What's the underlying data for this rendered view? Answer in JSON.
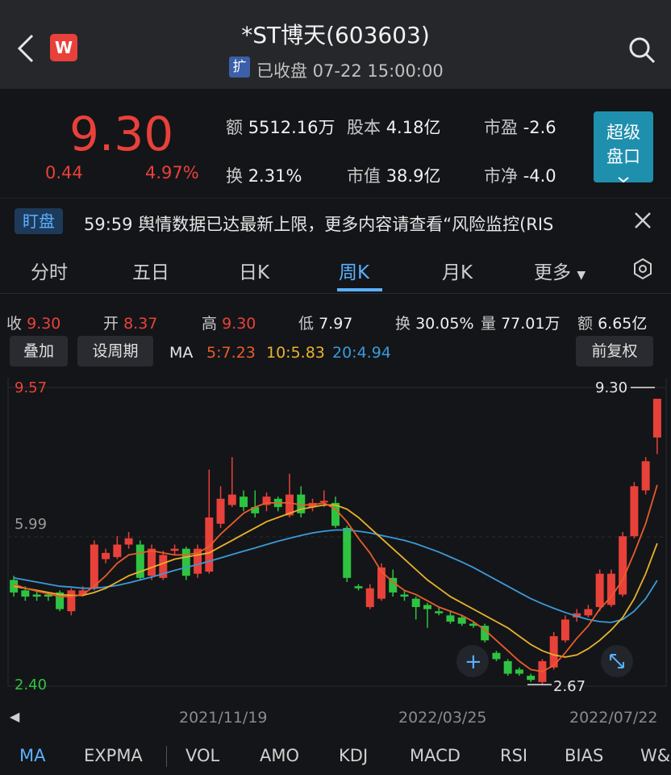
{
  "header": {
    "title": "*ST博天(603603)",
    "expand_tag": "扩",
    "status": "已收盘 07-22 15:00:00"
  },
  "quote": {
    "price": "9.30",
    "change": "0.44",
    "change_pct": "4.97%",
    "stats": [
      {
        "label": "额",
        "value": "5512.16万"
      },
      {
        "label": "股本",
        "value": "4.18亿"
      },
      {
        "label": "市盈",
        "value": "-2.6"
      },
      {
        "label": "换",
        "value": "2.31%"
      },
      {
        "label": "市值",
        "value": "38.9亿"
      },
      {
        "label": "市净",
        "value": "-4.0"
      }
    ],
    "super_button": [
      "超级",
      "盘口"
    ]
  },
  "marquee": {
    "tag": "盯盘",
    "text": "59:59 舆情数据已达最新上限，更多内容请查看“风险监控(RIS"
  },
  "tabs": [
    "分时",
    "五日",
    "日K",
    "周K",
    "月K",
    "更多"
  ],
  "active_tab": "周K",
  "ohlc": [
    {
      "label": "收",
      "value": "9.30",
      "color": "red"
    },
    {
      "label": "开",
      "value": "8.37",
      "color": "red"
    },
    {
      "label": "高",
      "value": "9.30",
      "color": "red"
    },
    {
      "label": "低",
      "value": "7.97",
      "color": "white"
    },
    {
      "label": "换",
      "value": "30.05%",
      "color": "white"
    },
    {
      "label": "量",
      "value": "77.01万",
      "color": "white"
    },
    {
      "label": "额",
      "value": "6.65亿",
      "color": "white"
    }
  ],
  "toolbar": {
    "overlay": "叠加",
    "period": "设周期",
    "ma_label": "MA",
    "ma5": "5:7.23",
    "ma10": "10:5.83",
    "ma20": "20:4.94",
    "adjust": "前复权"
  },
  "colors": {
    "up": "#e8413a",
    "down": "#2ec441",
    "ma5": "#e85c2a",
    "ma10": "#e8b22a",
    "ma20": "#3a9ad9",
    "accent": "#5ab0ff"
  },
  "chart_data": {
    "type": "candlestick",
    "y_labels": {
      "top": "9.57",
      "mid": "5.99",
      "bottom": "2.40"
    },
    "ylim": [
      2.4,
      9.57
    ],
    "annotations": {
      "max": "9.30",
      "min": "2.67"
    },
    "x_labels": [
      "2021/11/19",
      "2022/03/25",
      "2022/07/22"
    ],
    "candles": [
      {
        "o": 4.95,
        "c": 4.65,
        "h": 5.05,
        "l": 4.55
      },
      {
        "o": 4.7,
        "c": 4.55,
        "h": 4.8,
        "l": 4.45
      },
      {
        "o": 4.6,
        "c": 4.55,
        "h": 4.7,
        "l": 4.45
      },
      {
        "o": 4.6,
        "c": 4.55,
        "h": 4.65,
        "l": 4.45
      },
      {
        "o": 4.65,
        "c": 4.25,
        "h": 4.7,
        "l": 4.2
      },
      {
        "o": 4.2,
        "c": 4.7,
        "h": 4.75,
        "l": 4.1
      },
      {
        "o": 4.6,
        "c": 4.7,
        "h": 4.8,
        "l": 4.55
      },
      {
        "o": 4.75,
        "c": 5.8,
        "h": 5.9,
        "l": 4.7
      },
      {
        "o": 5.45,
        "c": 5.6,
        "h": 5.7,
        "l": 5.35
      },
      {
        "o": 5.5,
        "c": 5.8,
        "h": 6.0,
        "l": 5.45
      },
      {
        "o": 5.8,
        "c": 5.95,
        "h": 6.1,
        "l": 5.7
      },
      {
        "o": 5.8,
        "c": 5.0,
        "h": 5.9,
        "l": 4.95
      },
      {
        "o": 5.05,
        "c": 5.7,
        "h": 5.8,
        "l": 4.95
      },
      {
        "o": 5.0,
        "c": 5.55,
        "h": 5.65,
        "l": 4.95
      },
      {
        "o": 5.65,
        "c": 5.7,
        "h": 5.8,
        "l": 5.55
      },
      {
        "o": 5.7,
        "c": 5.05,
        "h": 5.75,
        "l": 4.95
      },
      {
        "o": 5.1,
        "c": 5.7,
        "h": 5.8,
        "l": 5.0
      },
      {
        "o": 5.15,
        "c": 6.45,
        "h": 7.6,
        "l": 5.1
      },
      {
        "o": 6.3,
        "c": 6.9,
        "h": 7.2,
        "l": 6.2
      },
      {
        "o": 6.75,
        "c": 7.0,
        "h": 7.9,
        "l": 6.7
      },
      {
        "o": 6.95,
        "c": 6.7,
        "h": 7.1,
        "l": 6.6
      },
      {
        "o": 6.7,
        "c": 6.55,
        "h": 7.1,
        "l": 6.45
      },
      {
        "o": 6.75,
        "c": 6.95,
        "h": 7.05,
        "l": 6.6
      },
      {
        "o": 6.9,
        "c": 6.7,
        "h": 6.95,
        "l": 6.6
      },
      {
        "o": 6.5,
        "c": 7.0,
        "h": 7.5,
        "l": 6.45
      },
      {
        "o": 7.0,
        "c": 6.55,
        "h": 7.2,
        "l": 6.45
      },
      {
        "o": 6.7,
        "c": 6.8,
        "h": 6.9,
        "l": 6.6
      },
      {
        "o": 6.85,
        "c": 6.85,
        "h": 7.1,
        "l": 6.7
      },
      {
        "o": 6.8,
        "c": 6.25,
        "h": 6.95,
        "l": 6.2
      },
      {
        "o": 6.2,
        "c": 5.0,
        "h": 6.25,
        "l": 4.9
      },
      {
        "o": 4.8,
        "c": 4.75,
        "h": 4.85,
        "l": 4.7
      },
      {
        "o": 4.3,
        "c": 4.75,
        "h": 4.85,
        "l": 4.25
      },
      {
        "o": 4.5,
        "c": 5.25,
        "h": 5.35,
        "l": 4.45
      },
      {
        "o": 5.0,
        "c": 4.65,
        "h": 5.2,
        "l": 4.55
      },
      {
        "o": 4.6,
        "c": 4.55,
        "h": 4.7,
        "l": 4.45
      },
      {
        "o": 4.5,
        "c": 4.3,
        "h": 4.55,
        "l": 4.0
      },
      {
        "o": 4.35,
        "c": 4.25,
        "h": 4.4,
        "l": 3.8
      },
      {
        "o": 4.2,
        "c": 4.15,
        "h": 4.3,
        "l": 4.1
      },
      {
        "o": 4.1,
        "c": 3.95,
        "h": 4.2,
        "l": 3.9
      },
      {
        "o": 4.05,
        "c": 3.9,
        "h": 4.1,
        "l": 3.85
      },
      {
        "o": 3.9,
        "c": 3.85,
        "h": 3.95,
        "l": 3.8
      },
      {
        "o": 3.85,
        "c": 3.5,
        "h": 3.9,
        "l": 3.45
      },
      {
        "o": 3.2,
        "c": 3.05,
        "h": 3.25,
        "l": 3.0
      },
      {
        "o": 3.0,
        "c": 2.7,
        "h": 3.05,
        "l": 2.65
      },
      {
        "o": 2.8,
        "c": 2.7,
        "h": 2.85,
        "l": 2.65
      },
      {
        "o": 2.65,
        "c": 2.55,
        "h": 2.7,
        "l": 2.5
      },
      {
        "o": 2.5,
        "c": 3.0,
        "h": 3.05,
        "l": 2.45
      },
      {
        "o": 2.85,
        "c": 3.6,
        "h": 3.7,
        "l": 2.8
      },
      {
        "o": 3.5,
        "c": 4.0,
        "h": 4.1,
        "l": 3.45
      },
      {
        "o": 4.05,
        "c": 4.15,
        "h": 4.25,
        "l": 3.95
      },
      {
        "o": 4.1,
        "c": 4.25,
        "h": 4.35,
        "l": 4.05
      },
      {
        "o": 4.3,
        "c": 5.1,
        "h": 5.2,
        "l": 4.2
      },
      {
        "o": 4.35,
        "c": 5.1,
        "h": 5.2,
        "l": 4.3
      },
      {
        "o": 4.6,
        "c": 6.0,
        "h": 6.1,
        "l": 4.55
      },
      {
        "o": 6.0,
        "c": 7.2,
        "h": 7.3,
        "l": 5.95
      },
      {
        "o": 7.1,
        "c": 7.8,
        "h": 7.9,
        "l": 7.0
      },
      {
        "o": 8.37,
        "c": 9.3,
        "h": 9.3,
        "l": 7.97
      }
    ],
    "ma5": [
      4.85,
      4.75,
      4.68,
      4.62,
      4.55,
      4.55,
      4.6,
      4.8,
      5.05,
      5.35,
      5.55,
      5.6,
      5.65,
      5.6,
      5.55,
      5.55,
      5.6,
      5.75,
      6.05,
      6.3,
      6.55,
      6.7,
      6.8,
      6.8,
      6.8,
      6.75,
      6.75,
      6.8,
      6.65,
      6.35,
      5.95,
      5.6,
      5.15,
      4.9,
      4.7,
      4.6,
      4.45,
      4.3,
      4.2,
      4.1,
      3.95,
      3.75,
      3.5,
      3.25,
      3.0,
      2.8,
      2.75,
      2.9,
      3.2,
      3.55,
      3.85,
      4.25,
      4.55,
      4.95,
      5.6,
      6.3,
      7.23
    ],
    "ma10": [
      4.8,
      4.75,
      4.7,
      4.65,
      4.6,
      4.58,
      4.58,
      4.65,
      4.75,
      4.9,
      5.05,
      5.15,
      5.25,
      5.35,
      5.45,
      5.5,
      5.55,
      5.6,
      5.75,
      5.9,
      6.05,
      6.2,
      6.35,
      6.45,
      6.55,
      6.65,
      6.7,
      6.75,
      6.75,
      6.65,
      6.45,
      6.2,
      5.95,
      5.7,
      5.45,
      5.2,
      4.95,
      4.75,
      4.55,
      4.4,
      4.25,
      4.1,
      3.95,
      3.8,
      3.6,
      3.4,
      3.25,
      3.15,
      3.1,
      3.15,
      3.3,
      3.5,
      3.75,
      4.05,
      4.5,
      5.1,
      5.83
    ],
    "ma20": [
      5.0,
      4.95,
      4.9,
      4.85,
      4.8,
      4.78,
      4.75,
      4.75,
      4.78,
      4.82,
      4.88,
      4.95,
      5.02,
      5.1,
      5.18,
      5.25,
      5.32,
      5.4,
      5.48,
      5.56,
      5.64,
      5.72,
      5.8,
      5.88,
      5.95,
      6.02,
      6.08,
      6.12,
      6.15,
      6.15,
      6.12,
      6.08,
      6.02,
      5.96,
      5.9,
      5.82,
      5.72,
      5.62,
      5.5,
      5.38,
      5.25,
      5.1,
      4.95,
      4.8,
      4.65,
      4.5,
      4.38,
      4.27,
      4.17,
      4.08,
      4.0,
      3.95,
      3.93,
      4.0,
      4.2,
      4.5,
      4.94
    ]
  },
  "bottom_tabs": [
    "MA",
    "EXPMA",
    "VOL",
    "AMO",
    "KDJ",
    "MACD",
    "RSI",
    "BIAS",
    "W&R"
  ],
  "bottom_active": "MA"
}
